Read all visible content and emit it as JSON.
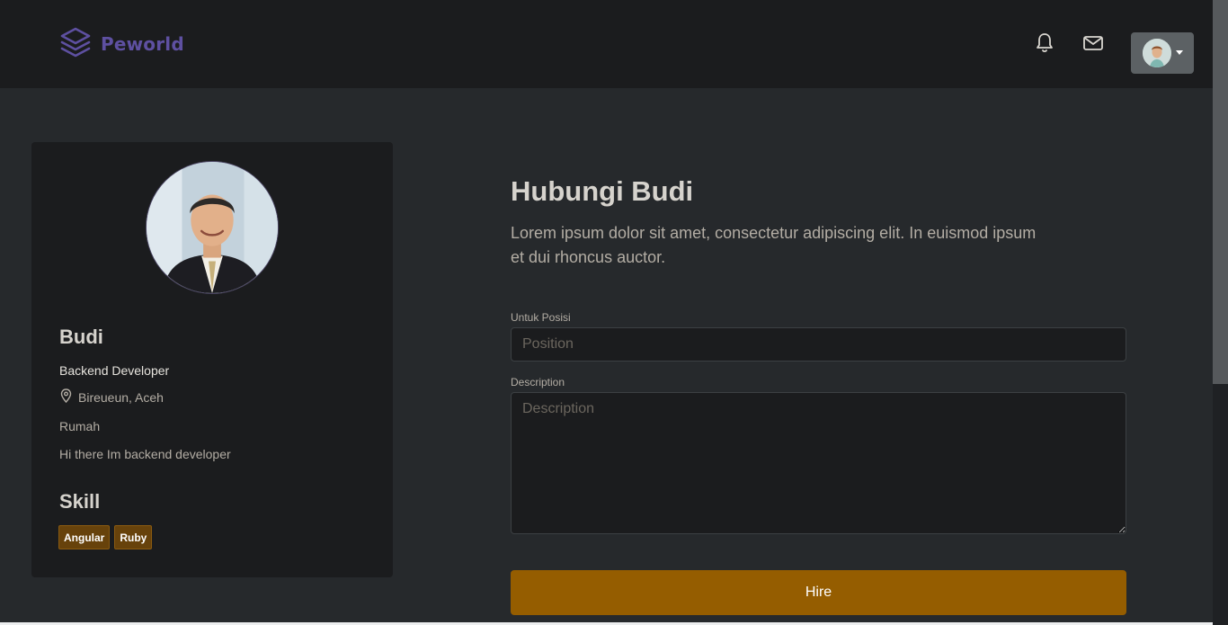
{
  "navbar": {
    "brand": "Peworld",
    "icons": {
      "notifications": "bell-icon",
      "messages": "mail-icon",
      "logo": "layers-icon"
    }
  },
  "profile": {
    "name": "Budi",
    "job": "Backend Developer",
    "location": "Bireueun, Aceh",
    "workplace": "Rumah",
    "bio": "Hi there Im backend developer",
    "skill_title": "Skill",
    "skills": [
      "Angular",
      "Ruby"
    ]
  },
  "hire": {
    "title": "Hubungi Budi",
    "description": "Lorem ipsum dolor sit amet, consectetur adipiscing elit. In euismod ipsum et dui rhoncus auctor.",
    "position_label": "Untuk Posisi",
    "position_placeholder": "Position",
    "position_value": "",
    "description_label": "Description",
    "description_placeholder": "Description",
    "description_value": "",
    "button_label": "Hire"
  },
  "colors": {
    "page_bg": "#26292c",
    "navbar_bg": "#1b1c1e",
    "brand": "#5e50a1",
    "accent": "#955d00",
    "skill_badge": "#67420b"
  }
}
